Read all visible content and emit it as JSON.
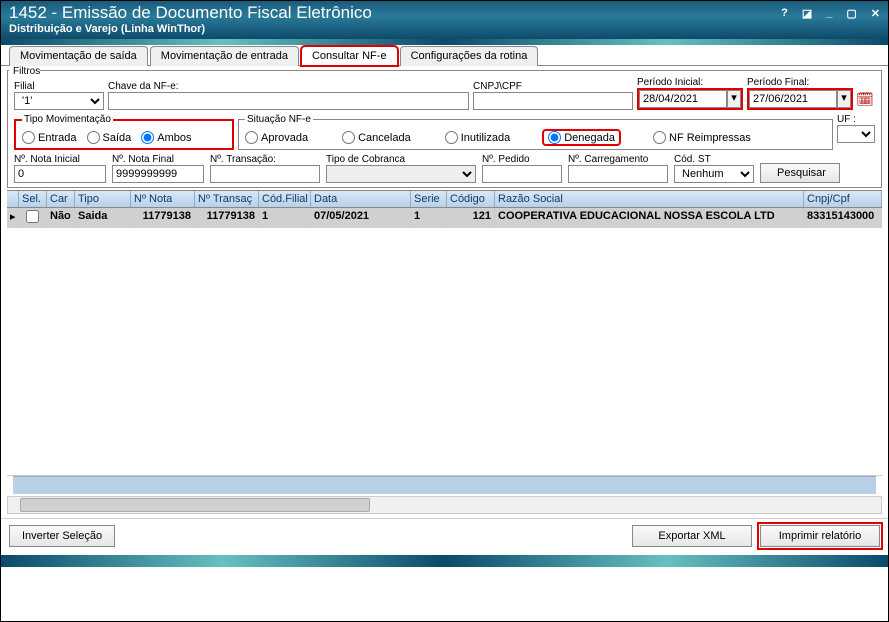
{
  "titlebar": {
    "title": "1452 - Emissão de Documento Fiscal Eletrônico",
    "subtitle": "Distribuição e Varejo (Linha WinThor)"
  },
  "tabs": {
    "t1": "Movimentação de saída",
    "t2": "Movimentação de entrada",
    "t3": "Consultar NF-e",
    "t4": "Configurações da rotina"
  },
  "filters": {
    "group": "Filtros",
    "filial": {
      "label": "Filial",
      "value": "'1'"
    },
    "chave": {
      "label": "Chave da NF-e:",
      "value": ""
    },
    "cnpj": {
      "label": "CNPJ\\CPF",
      "value": ""
    },
    "periodo_inicial": {
      "label": "Período Inicial:",
      "value": "28/04/2021"
    },
    "periodo_final": {
      "label": "Período Final:",
      "value": "27/06/2021"
    },
    "tipo_mov": {
      "legend": "Tipo Movimentação",
      "options": {
        "entrada": "Entrada",
        "saida": "Saída",
        "ambos": "Ambos"
      },
      "selected": "ambos"
    },
    "situacao": {
      "legend": "Situação NF-e",
      "options": {
        "aprovada": "Aprovada",
        "cancelada": "Cancelada",
        "inutilizada": "Inutilizada",
        "denegada": "Denegada",
        "reimp": "NF Reimpressas"
      },
      "selected": "denegada"
    },
    "uf": {
      "label": "UF :",
      "value": ""
    },
    "nota_inicial": {
      "label": "Nº. Nota Inicial",
      "value": "0"
    },
    "nota_final": {
      "label": "Nº. Nota Final",
      "value": "9999999999"
    },
    "transacao": {
      "label": "Nº. Transação:",
      "value": ""
    },
    "tipo_cobranca": {
      "label": "Tipo de Cobranca",
      "value": ""
    },
    "pedido": {
      "label": "Nº. Pedido",
      "value": ""
    },
    "carregamento": {
      "label": "Nº. Carregamento",
      "value": ""
    },
    "cod_st": {
      "label": "Cód. ST",
      "value": "Nenhum"
    },
    "pesquisar": "Pesquisar"
  },
  "grid": {
    "headers": {
      "sel": "Sel.",
      "car": "Car",
      "tipo": "Tipo",
      "nnota": "Nº Nota",
      "ntrans": "Nº Transaç",
      "cfilial": "Cód.Filial",
      "data": "Data",
      "serie": "Serie",
      "codigo": "Código",
      "razao": "Razão Social",
      "cnpj": "Cnpj/Cpf"
    },
    "rows": [
      {
        "sel": false,
        "car": "Não",
        "tipo": "Saida",
        "nnota": "11779138",
        "ntrans": "11779138",
        "cfilial": "1",
        "data": "07/05/2021",
        "serie": "1",
        "codigo": "121",
        "razao": "COOPERATIVA EDUCACIONAL NOSSA ESCOLA LTD",
        "cnpj": "83315143000"
      }
    ]
  },
  "bottom": {
    "inverter": "Inverter Seleção",
    "exportar": "Exportar XML",
    "imprimir": "Imprimir relatório"
  }
}
